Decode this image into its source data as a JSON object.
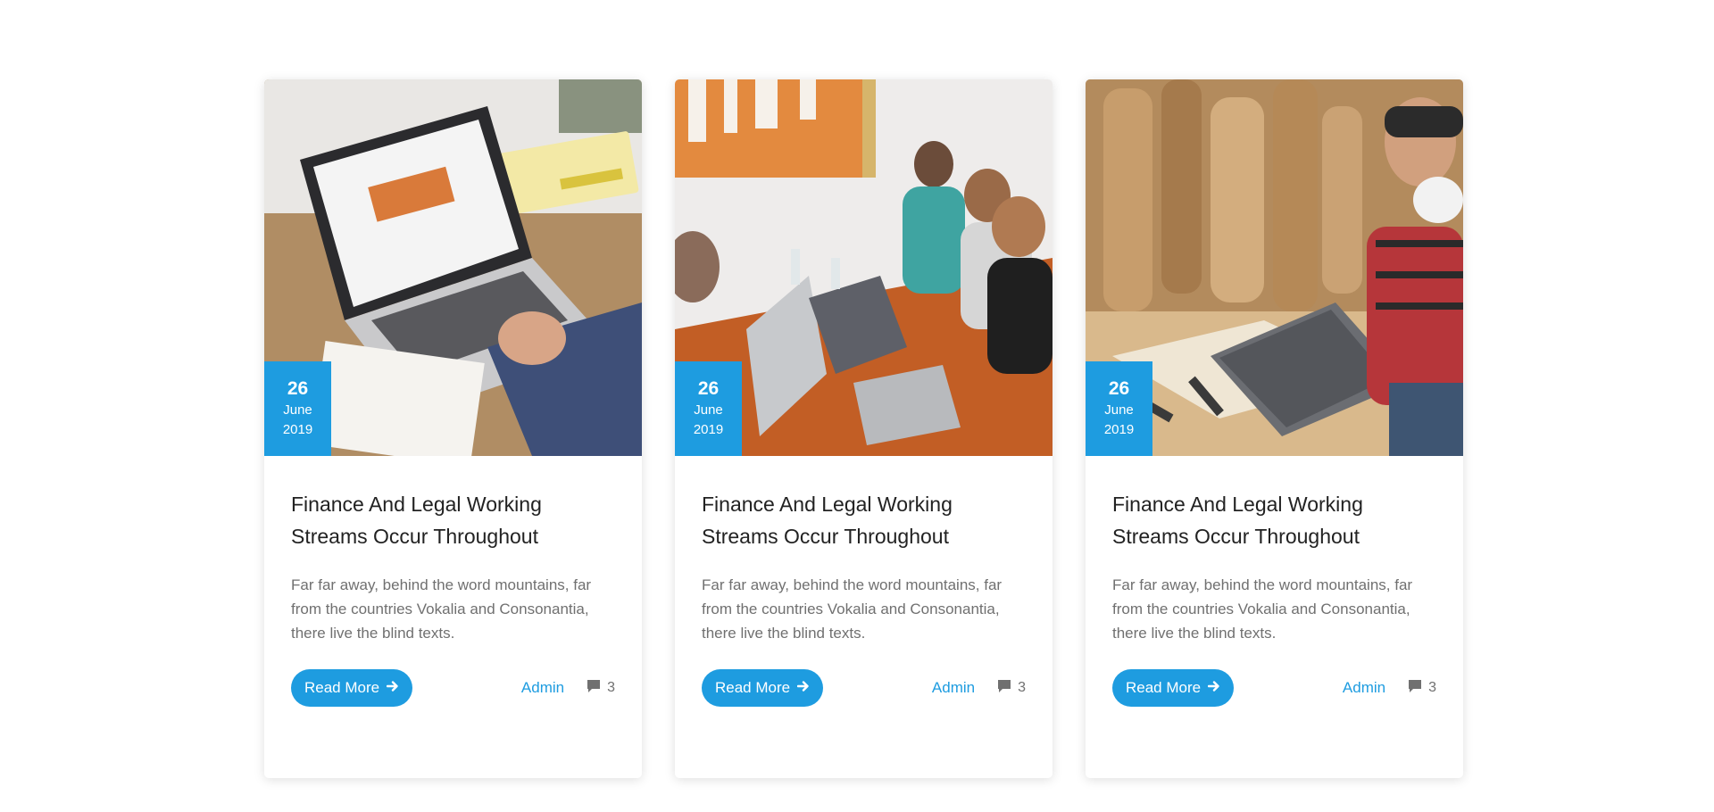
{
  "colors": {
    "accent": "#1e9ce0",
    "title": "#222222",
    "text": "#707070"
  },
  "cards": [
    {
      "image": "laptop-on-desk-photo",
      "date": {
        "day": "26",
        "month": "June",
        "year": "2019"
      },
      "title_line1": "Finance And Legal Working",
      "title_line2": "Streams Occur Throughout",
      "excerpt_line1": "Far far away, behind the word mountains, far",
      "excerpt_line2": "from the countries Vokalia and Consonantia,",
      "excerpt_line3": "there live the blind texts.",
      "read_more": "Read More",
      "author": "Admin",
      "comments": "3"
    },
    {
      "image": "team-meeting-with-laptops-photo",
      "date": {
        "day": "26",
        "month": "June",
        "year": "2019"
      },
      "title_line1": "Finance And Legal Working",
      "title_line2": "Streams Occur Throughout",
      "excerpt_line1": "Far far away, behind the word mountains, far",
      "excerpt_line2": "from the countries Vokalia and Consonantia,",
      "excerpt_line3": "there live the blind texts.",
      "read_more": "Read More",
      "author": "Admin",
      "comments": "3"
    },
    {
      "image": "woodworker-with-laptop-photo",
      "date": {
        "day": "26",
        "month": "June",
        "year": "2019"
      },
      "title_line1": "Finance And Legal Working",
      "title_line2": "Streams Occur Throughout",
      "excerpt_line1": "Far far away, behind the word mountains, far",
      "excerpt_line2": "from the countries Vokalia and Consonantia,",
      "excerpt_line3": "there live the blind texts.",
      "read_more": "Read More",
      "author": "Admin",
      "comments": "3"
    }
  ]
}
